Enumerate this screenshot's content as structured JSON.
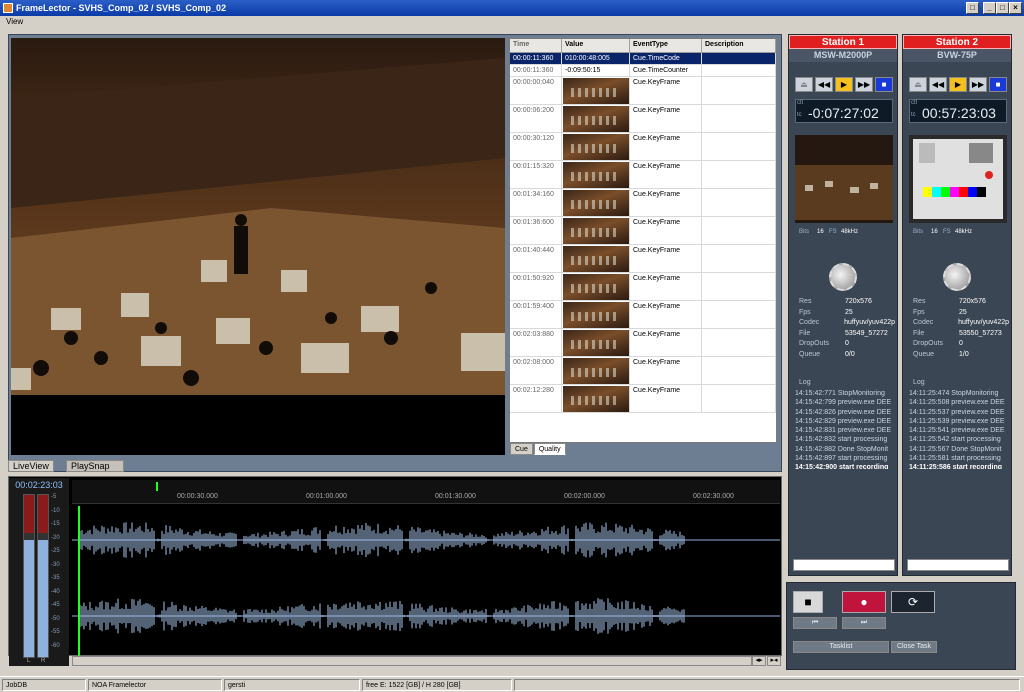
{
  "window": {
    "title": "FrameLector - SVHS_Comp_02 / SVHS_Comp_02",
    "min_label": "_",
    "max_label": "□",
    "close_label": "×",
    "help_label": "□"
  },
  "menu": {
    "view": "View"
  },
  "grid": {
    "columns": [
      "Time",
      "Value",
      "EventType",
      "Description"
    ],
    "rows": [
      {
        "time": "00:00:11:360",
        "value": "010:00:48:005",
        "event": "Cue.TimeCode",
        "desc": ""
      },
      {
        "time": "00:00:11:360",
        "value": "-0:09:50:15",
        "event": "Cue.TimeCounter",
        "desc": ""
      },
      {
        "time": "00:00:00:040",
        "value": "",
        "event": "Cue.KeyFrame",
        "desc": ""
      },
      {
        "time": "00:00:06:200",
        "value": "",
        "event": "Cue.KeyFrame",
        "desc": ""
      },
      {
        "time": "00:00:30:120",
        "value": "",
        "event": "Cue.KeyFrame",
        "desc": ""
      },
      {
        "time": "00:01:15:320",
        "value": "",
        "event": "Cue.KeyFrame",
        "desc": ""
      },
      {
        "time": "00:01:34:160",
        "value": "",
        "event": "Cue.KeyFrame",
        "desc": ""
      },
      {
        "time": "00:01:36:600",
        "value": "",
        "event": "Cue.KeyFrame",
        "desc": ""
      },
      {
        "time": "00:01:40:440",
        "value": "",
        "event": "Cue.KeyFrame",
        "desc": ""
      },
      {
        "time": "00:01:50:920",
        "value": "",
        "event": "Cue.KeyFrame",
        "desc": ""
      },
      {
        "time": "00:01:59:400",
        "value": "",
        "event": "Cue.KeyFrame",
        "desc": ""
      },
      {
        "time": "00:02:03:880",
        "value": "",
        "event": "Cue.KeyFrame",
        "desc": ""
      },
      {
        "time": "00:02:08:000",
        "value": "",
        "event": "Cue.KeyFrame",
        "desc": ""
      },
      {
        "time": "00:02:12:280",
        "value": "",
        "event": "Cue.KeyFrame",
        "desc": ""
      }
    ],
    "tabs": [
      "Cue",
      "Quality"
    ]
  },
  "viewtabs": {
    "liveview": "LiveView",
    "playsnap": "PlaySnap"
  },
  "audio": {
    "position": "00:02:23:03",
    "ticks": [
      "00:00:30.000",
      "00:01:00.000",
      "00:01:30.000",
      "00:02:00.000",
      "00:02:30.000"
    ],
    "db_scale": [
      "-5",
      "-10",
      "-15",
      "-20",
      "-25",
      "-30",
      "-35",
      "-40",
      "-45",
      "-50",
      "-55",
      "-60"
    ],
    "channels": [
      "L",
      "R"
    ],
    "left_level": 0.72,
    "right_level": 0.72
  },
  "station1": {
    "name": "Station 1",
    "device": "MSW-M2000P",
    "ctl": "ctl",
    "tc": "tc",
    "timecode": "-0:07:27:02",
    "bits_label": "Bits",
    "bits": "16",
    "fs_label": "FS",
    "fs": "48kHz",
    "props": [
      [
        "Res",
        "720x576"
      ],
      [
        "Fps",
        "25"
      ],
      [
        "Codec",
        "huffyuv/yuv422p"
      ],
      [
        "File",
        "53549_57272"
      ],
      [
        "DropOuts",
        "0"
      ],
      [
        "Queue",
        "0/0"
      ]
    ],
    "log_title": "Log",
    "log": [
      "14:15:42:771 StopMonitoring",
      "14:15:42:799 preview.exe DEE",
      "14:15:42:826 preview.exe DEE",
      "14:15:42:829 preview.exe DEE",
      "14:15:42:831 preview.exe DEE",
      "14:15:42:832 start processing",
      "14:15:42:882 Done StopMonit",
      "14:15:42:897 start processing",
      "14:15:42:900 start recording"
    ]
  },
  "station2": {
    "name": "Station 2",
    "device": "BVW-75P",
    "ctl": "ctl",
    "tc": "tc",
    "timecode": "00:57:23:03",
    "bits_label": "Bits",
    "bits": "16",
    "fs_label": "FS",
    "fs": "48kHz",
    "props": [
      [
        "Res",
        "720x576"
      ],
      [
        "Fps",
        "25"
      ],
      [
        "Codec",
        "huffyuv/yuv422p"
      ],
      [
        "File",
        "53550_57273"
      ],
      [
        "DropOuts",
        "0"
      ],
      [
        "Queue",
        "1/0"
      ]
    ],
    "log_title": "Log",
    "log": [
      "14:11:25:474 StopMonitoring",
      "14:11:25:508 preview.exe DEE",
      "14:11:25:537 preview.exe DEE",
      "14:11:25:539 preview.exe DEE",
      "14:11:25:541 preview.exe DEE",
      "14:11:25:542 start processing",
      "14:11:25:567 Done StopMonit",
      "14:11:25:581 start processing",
      "14:11:25:586 start recording"
    ]
  },
  "transport": {
    "stop": "■",
    "record": "●",
    "loop": "⟳",
    "prev": "⏮",
    "next": "⏭",
    "rew": "◀◀",
    "play": "▶",
    "ff": "▶▶",
    "eject": "⏏"
  },
  "tasks": {
    "tasklist": "Tasklist",
    "close": "Close Task"
  },
  "status": {
    "db": "JobDB",
    "app": "NOA Framelector",
    "user": "gersti",
    "free": "free E: 1522 [GB] / H 280 [GB]"
  },
  "colors": {
    "accent_red": "#e02020",
    "panel": "#3b4654",
    "wave": "#8fb1de",
    "grid_select": "#0a246a"
  }
}
